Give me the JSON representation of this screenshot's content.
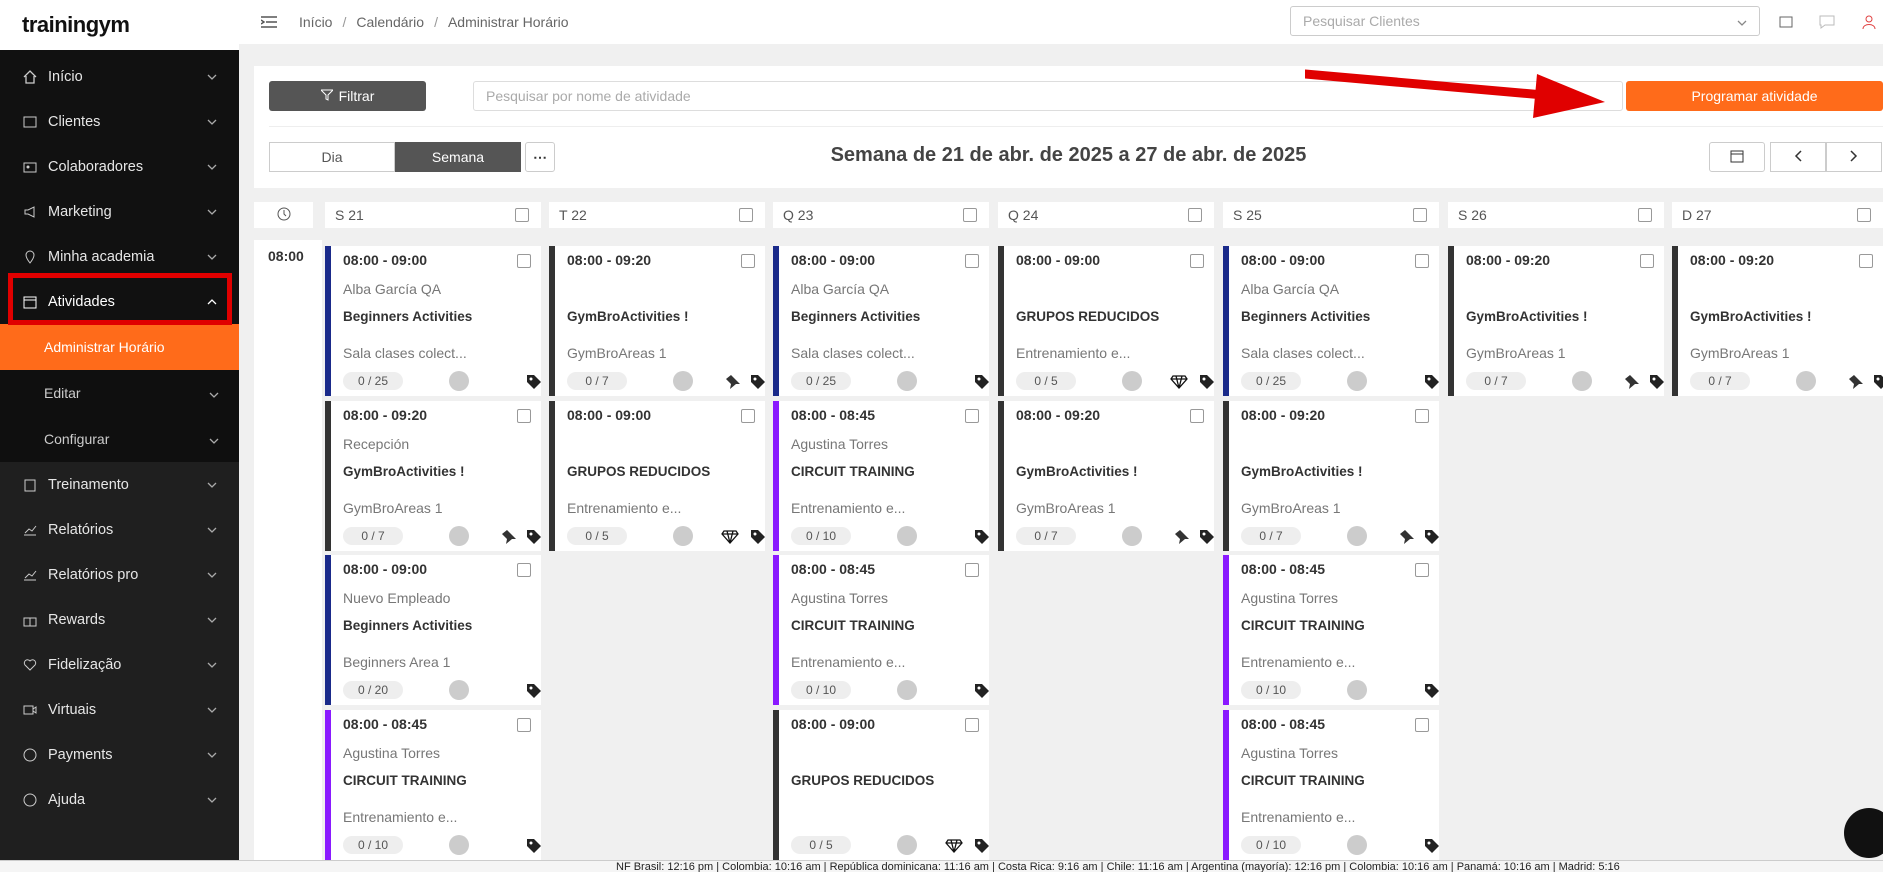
{
  "app": {
    "logo": "trainingym"
  },
  "sidebar": {
    "items": [
      {
        "label": "Início",
        "icon": "home-icon"
      },
      {
        "label": "Clientes",
        "icon": "id-card-icon"
      },
      {
        "label": "Colaboradores",
        "icon": "badge-icon"
      },
      {
        "label": "Marketing",
        "icon": "megaphone-icon"
      },
      {
        "label": "Minha academia",
        "icon": "location-pin-icon"
      },
      {
        "label": "Atividades",
        "icon": "calendar-icon"
      }
    ],
    "sub_items": [
      {
        "label": "Administrar Horário"
      },
      {
        "label": "Editar"
      },
      {
        "label": "Configurar"
      }
    ],
    "items_after": [
      {
        "label": "Treinamento",
        "icon": "clipboard-icon"
      },
      {
        "label": "Relatórios",
        "icon": "chart-icon"
      },
      {
        "label": "Relatórios pro",
        "icon": "chart-pro-icon"
      },
      {
        "label": "Rewards",
        "icon": "gift-icon"
      },
      {
        "label": "Fidelização",
        "icon": "heart-icon"
      },
      {
        "label": "Virtuais",
        "icon": "video-icon"
      },
      {
        "label": "Payments",
        "icon": "dollar-icon"
      },
      {
        "label": "Ajuda",
        "icon": "help-icon"
      }
    ]
  },
  "breadcrumb": {
    "items": [
      "Início",
      "Calendário",
      "Administrar Horário"
    ]
  },
  "header": {
    "client_search_placeholder": "Pesquisar Clientes"
  },
  "toolbar": {
    "filter_label": "Filtrar",
    "activity_search_placeholder": "Pesquisar por nome de atividade",
    "program_label": "Programar atividade",
    "view_day": "Dia",
    "view_week": "Semana",
    "week_title": "Semana de 21 de abr. de 2025 a 27 de abr. de 2025"
  },
  "calendar": {
    "time_label": "08:00",
    "days": [
      "S 21",
      "T 22",
      "Q 23",
      "Q 24",
      "S 25",
      "S 26",
      "D 27"
    ],
    "cards": [
      {
        "time": "08:00 - 09:00",
        "instructor": "Alba García QA",
        "name": "Beginners Activities",
        "area": "Sala clases colect...",
        "cap": "0 / 25",
        "color": "#1a2a8a"
      },
      {
        "time": "08:00 - 09:20",
        "instructor": "Recepción",
        "name": "GymBroActivities !",
        "area": "GymBroAreas 1",
        "cap": "0 / 7",
        "color": "#333333"
      },
      {
        "time": "08:00 - 09:00",
        "instructor": "Nuevo Empleado",
        "name": "Beginners Activities",
        "area": "Beginners Area 1",
        "cap": "0 / 20",
        "color": "#1a2a8a"
      },
      {
        "time": "08:00 - 08:45",
        "instructor": "Agustina Torres",
        "name": "CIRCUIT TRAINING",
        "area": "Entrenamiento e...",
        "cap": "0 / 10",
        "color": "#8a1aff"
      },
      {
        "time": "08:00 - 09:20",
        "instructor": "",
        "name": "GymBroActivities !",
        "area": "GymBroAreas 1",
        "cap": "0 / 7",
        "color": "#333333"
      },
      {
        "time": "08:00 - 09:00",
        "instructor": "",
        "name": "GRUPOS REDUCIDOS",
        "area": "Entrenamiento e...",
        "cap": "0 / 5",
        "color": "#333333"
      },
      {
        "time": "08:00 - 09:00",
        "instructor": "Alba García QA",
        "name": "Beginners Activities",
        "area": "Sala clases colect...",
        "cap": "0 / 25",
        "color": "#1a2a8a"
      },
      {
        "time": "08:00 - 08:45",
        "instructor": "Agustina Torres",
        "name": "CIRCUIT TRAINING",
        "area": "Entrenamiento e...",
        "cap": "0 / 10",
        "color": "#8a1aff"
      },
      {
        "time": "08:00 - 08:45",
        "instructor": "Agustina Torres",
        "name": "CIRCUIT TRAINING",
        "area": "Entrenamiento e...",
        "cap": "0 / 10",
        "color": "#8a1aff"
      },
      {
        "time": "08:00 - 09:00",
        "instructor": "",
        "name": "GRUPOS REDUCIDOS",
        "area": "",
        "cap": "0 / 5",
        "color": "#333333"
      },
      {
        "time": "08:00 - 09:00",
        "instructor": "",
        "name": "GRUPOS REDUCIDOS",
        "area": "Entrenamiento e...",
        "cap": "0 / 5",
        "color": "#333333"
      },
      {
        "time": "08:00 - 09:20",
        "instructor": "",
        "name": "GymBroActivities !",
        "area": "GymBroAreas 1",
        "cap": "0 / 7",
        "color": "#333333"
      },
      {
        "time": "08:00 - 09:00",
        "instructor": "Alba García QA",
        "name": "Beginners Activities",
        "area": "Sala clases colect...",
        "cap": "0 / 25",
        "color": "#1a2a8a"
      },
      {
        "time": "08:00 - 09:20",
        "instructor": "",
        "name": "GymBroActivities !",
        "area": "GymBroAreas 1",
        "cap": "0 / 7",
        "color": "#333333"
      },
      {
        "time": "08:00 - 08:45",
        "instructor": "Agustina Torres",
        "name": "CIRCUIT TRAINING",
        "area": "Entrenamiento e...",
        "cap": "0 / 10",
        "color": "#8a1aff"
      },
      {
        "time": "08:00 - 08:45",
        "instructor": "Agustina Torres",
        "name": "CIRCUIT TRAINING",
        "area": "Entrenamiento e...",
        "cap": "0 / 10",
        "color": "#8a1aff"
      },
      {
        "time": "08:00 - 09:20",
        "instructor": "",
        "name": "GymBroActivities !",
        "area": "GymBroAreas 1",
        "cap": "0 / 7",
        "color": "#333333"
      },
      {
        "time": "08:00 - 09:20",
        "instructor": "",
        "name": "GymBroActivities !",
        "area": "GymBroAreas 1",
        "cap": "0 / 7",
        "color": "#333333"
      }
    ]
  },
  "status_bar": {
    "text": "NF Brasil: 12:16 pm | Colombia: 10:16 am | República dominicana: 11:16 am | Costa Rica: 9:16 am | Chile: 11:16 am | Argentina (mayoría): 12:16 pm | Colombia: 10:16 am | Panamá: 10:16 am | Madrid: 5:16"
  },
  "colors": {
    "accent": "#ff6b1a",
    "sidebar": "#111111",
    "highlight": "#e00000"
  }
}
